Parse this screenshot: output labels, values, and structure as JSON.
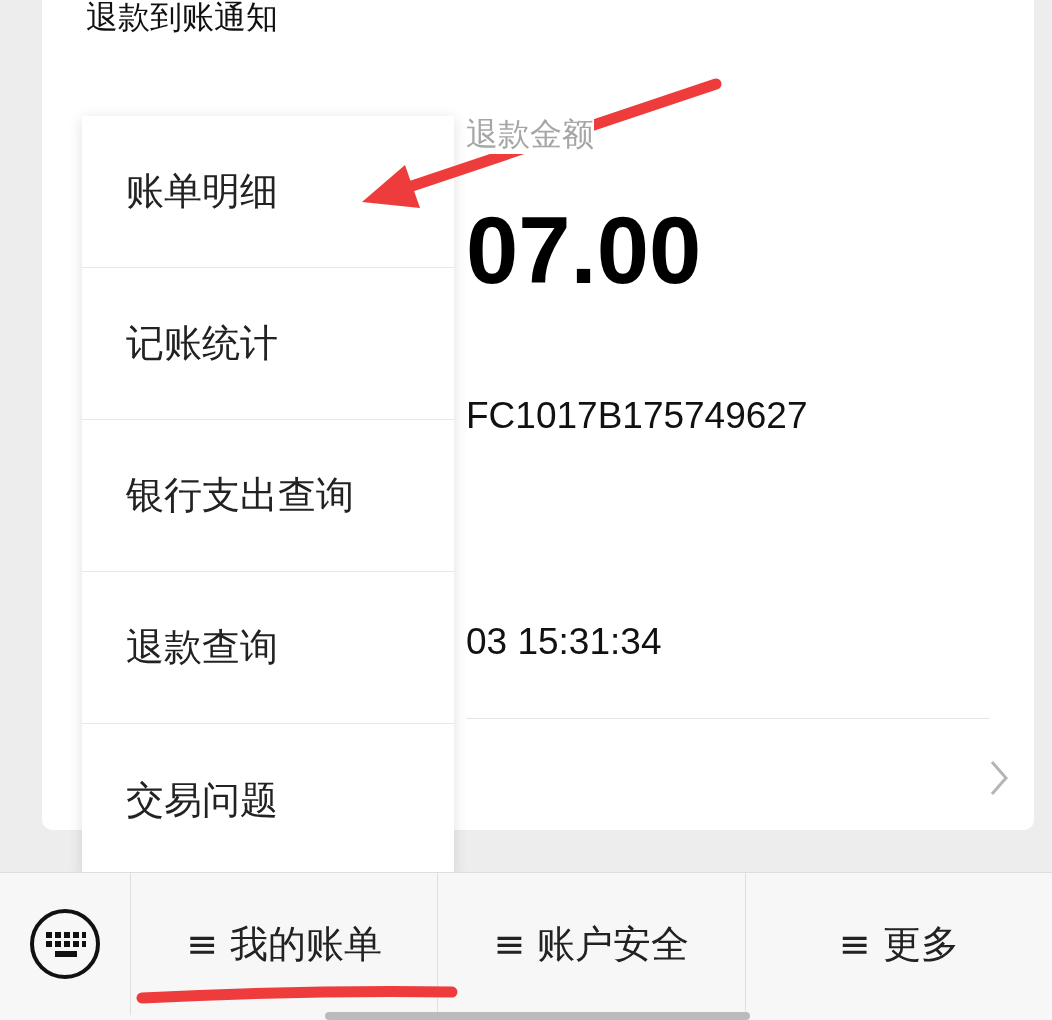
{
  "card": {
    "title": "退款到账通知",
    "amount_label": "退款金额",
    "amount": "07.00",
    "field_1_value": "FC1017B175749627",
    "field_2_value": "03 15:31:34"
  },
  "menu": {
    "items": [
      {
        "label": "账单明细"
      },
      {
        "label": "记账统计"
      },
      {
        "label": "银行支出查询"
      },
      {
        "label": "退款查询"
      },
      {
        "label": "交易问题"
      }
    ]
  },
  "bottom_bar": {
    "tabs": [
      {
        "label": "≡ 我的账单"
      },
      {
        "label": "≡ 账户安全"
      },
      {
        "label": "≡ 更多"
      }
    ]
  }
}
